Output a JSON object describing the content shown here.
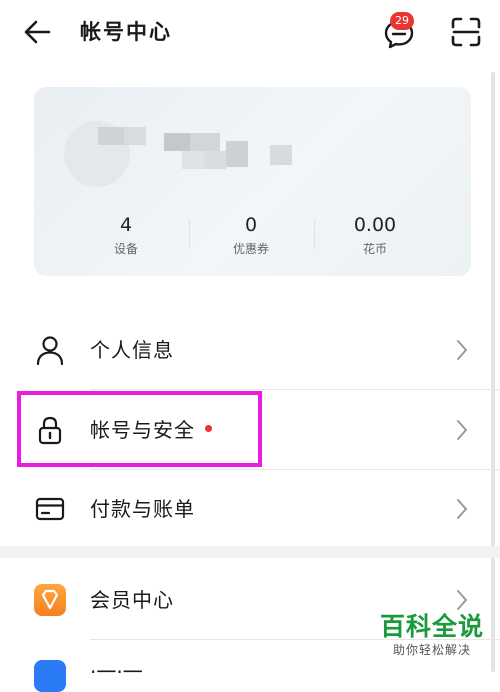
{
  "header": {
    "title": "帐号中心",
    "message_badge": "29"
  },
  "stats": [
    {
      "value": "4",
      "label": "设备"
    },
    {
      "value": "0",
      "label": "优惠券"
    },
    {
      "value": "0.00",
      "label": "花币"
    }
  ],
  "menu": {
    "personal_info": "个人信息",
    "account_security": "帐号与安全",
    "payment_bills": "付款与账单",
    "member_center": "会员中心",
    "partial_item": "·一·一"
  },
  "watermark": {
    "title": "百科全说",
    "subtitle": "助你轻松解决"
  },
  "colors": {
    "accent_red": "#e8352f",
    "highlight_magenta": "#e81ddf",
    "member_orange": "#f5811e",
    "blue_icon": "#2b7bf6",
    "watermark_green": "#1a9a3a"
  },
  "icons": {
    "back": "arrow-left-icon",
    "message": "chat-bubble-icon",
    "scan": "scan-icon",
    "person": "person-icon",
    "lock": "lock-icon",
    "card": "credit-card-icon",
    "member": "diamond-icon",
    "chevron": "chevron-right-icon"
  }
}
